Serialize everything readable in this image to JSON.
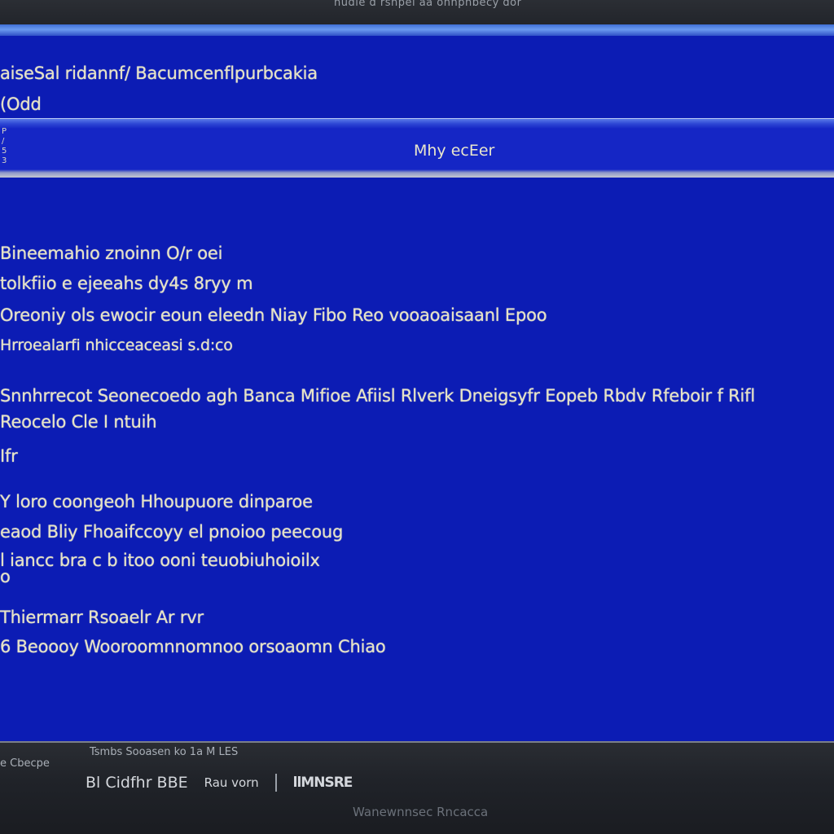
{
  "window": {
    "top_title": "hudie d rshpel aa ohnpnbecy dor",
    "bottom_line1": "Tsmbs  Sooasen ko 1a  M LES",
    "bottom_left": "e  Cbecpe",
    "footer": "Wanewnnsec Rncacca"
  },
  "header": {
    "line1": "aiseSal ridannf/ Bacumcenflpurbcakia",
    "line2": "(Odd",
    "bar_title": "Mhy ecEer",
    "bar_ticks": "P\n/\n5\n3"
  },
  "body": {
    "lines": [
      "Bineemahio  znoinn  O/r oei",
      "tolkfiio  e  ejeeahs dy4s  8ryy  m",
      "Oreoniy  ols  ewocir  eoun  eleedn  Niay  Fibo  Reo  vooaoaisaanl  Epoo",
      "Hrroealarfi  nhicceaceasi s.d:co",
      "Snnhrrecot  Seonecoedo  agh  Banca  Mifioe  Afiisl  Rlverk  Dneigsyfr  Eopeb  Rbdv  Rfeboir  f  Rifl",
      "Reocelo  Cle  I  ntuih",
      "Ifr",
      "Y  loro  coongeoh  Hhoupuore  dinparoe",
      "  eaod  Bliy  Fhoaifccoyy  el  pnoioo  peecoug",
      "l  iancc  bra  c  b  itoo  ooni  teuobiuhoioilx",
      "o",
      "Thiermarr  Rsoaelr  Ar  rvr",
      "6  Beoooy  Wooroomnnomnoo  orsoaomn  Chiao"
    ]
  },
  "status": {
    "item1": "Bl Cidfhr BBE",
    "item2": "Rau vorn",
    "item3": "llMNSRE"
  }
}
